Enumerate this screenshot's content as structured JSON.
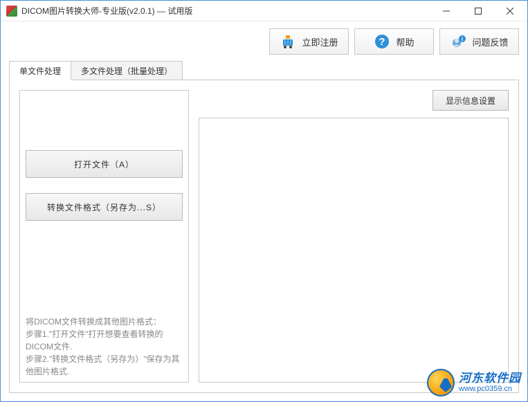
{
  "titlebar": {
    "title": "DICOM图片转换大师-专业版(v2.0.1) — 试用版"
  },
  "toolbar": {
    "register_label": "立即注册",
    "help_label": "帮助",
    "feedback_label": "问题反馈"
  },
  "tabs": {
    "single_label": "单文件处理",
    "batch_label": "多文件处理（批量处理）"
  },
  "actions": {
    "open_file_label": "打开文件（A）",
    "convert_label": "转换文件格式（另存为...S）",
    "display_settings_label": "显示信息设置"
  },
  "help_text": {
    "line1": "将DICOM文件转换成其他图片格式：",
    "line2": " 步骤1.\"打开文件\"打开想要查看转换的DICOM文件.",
    "line3": " 步骤2.\"转换文件格式（另存为）\"保存为其他图片格式."
  },
  "watermark": {
    "title": "河东软件园",
    "url": "www.pc0359.cn"
  }
}
